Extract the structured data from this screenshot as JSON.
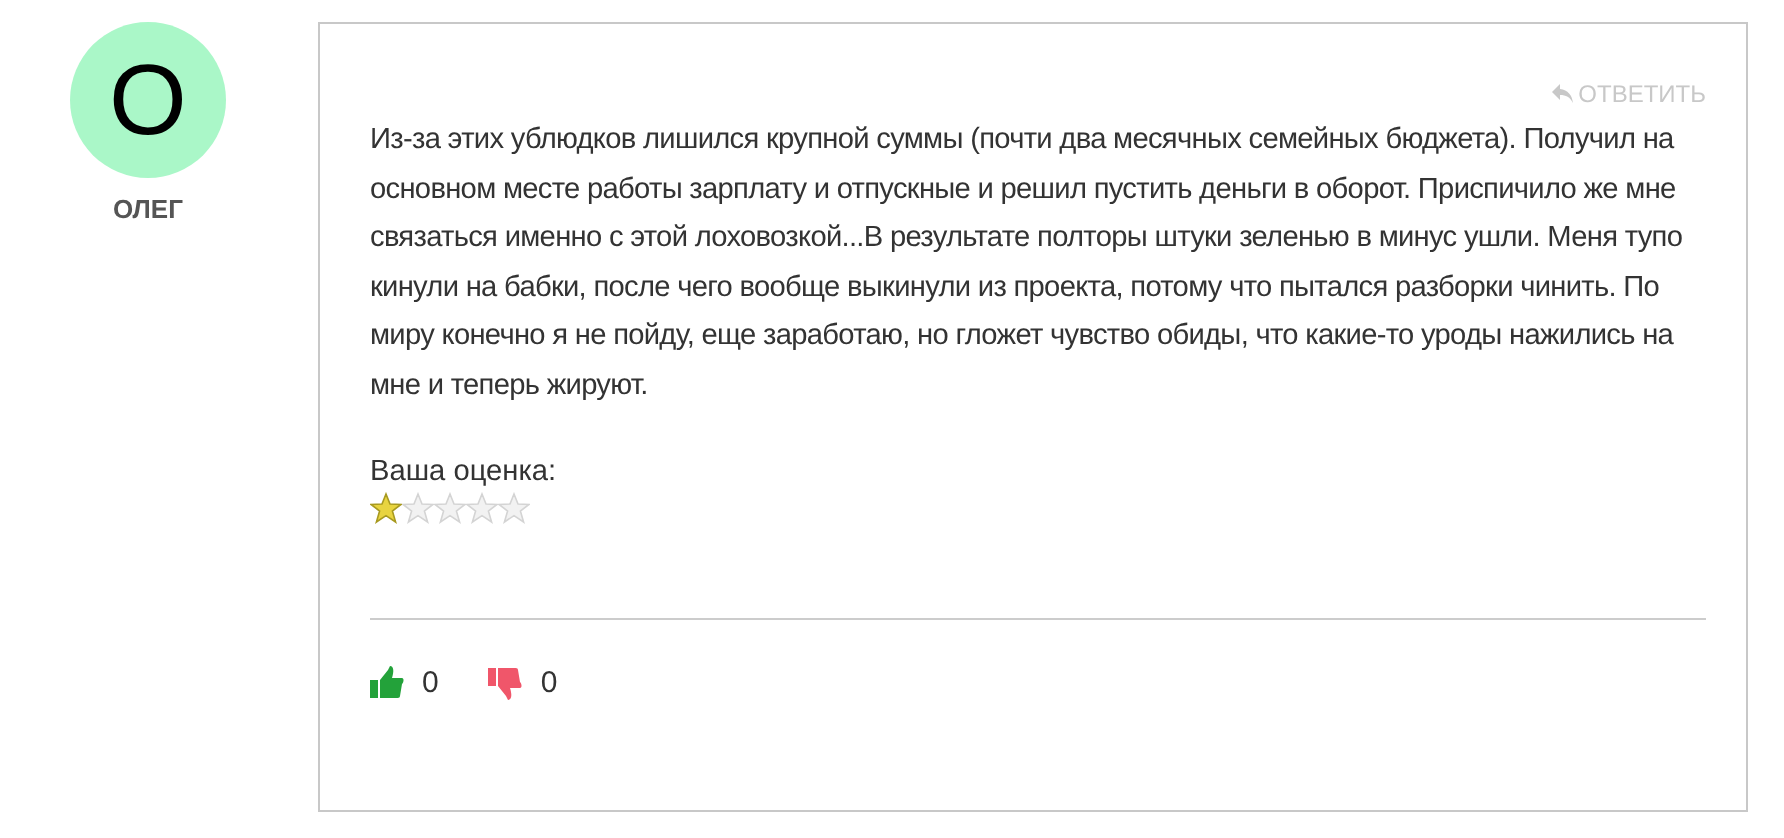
{
  "author": {
    "initial": "О",
    "name": "ОЛЕГ",
    "color": "#aaf7c8"
  },
  "reply": {
    "label": "ОТВЕТИТЬ"
  },
  "comment": {
    "text": "Из-за этих ублюдков лишился крупной суммы (почти два месячных семейных бюджета). Получил на основном месте работы зарплату и отпускные и решил пустить деньги в оборот. Приспичило же мне связаться именно с этой лоховозкой...В результате полторы штуки зеленью в минус ушли. Меня тупо кинули на бабки, после чего вообще выкинули из проекта, потому что пытался разборки чинить. По миру конечно я не пойду, еще заработаю, но гложет чувство обиды, что какие-то уроды нажились на мне и теперь жируют."
  },
  "rating": {
    "label": "Ваша оценка:",
    "stars": 1
  },
  "votes": [
    {
      "kind": "like",
      "count": "0"
    },
    {
      "kind": "dislike",
      "count": "0"
    }
  ]
}
